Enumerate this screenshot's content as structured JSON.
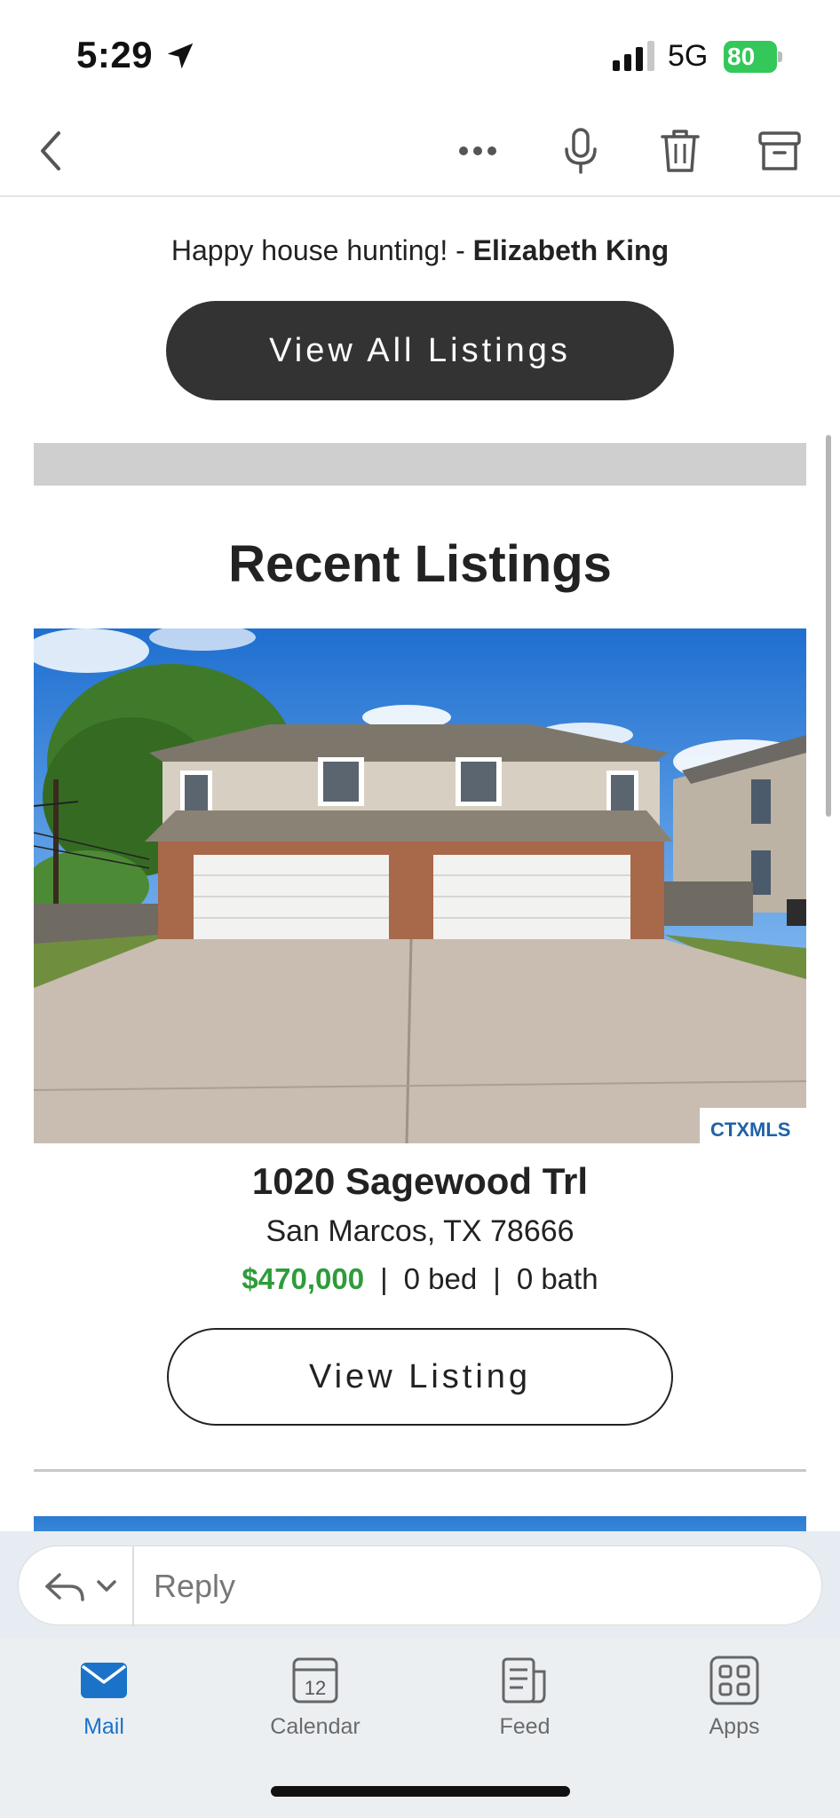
{
  "status_bar": {
    "time": "5:29",
    "network": "5G",
    "battery": "80"
  },
  "toolbar": {
    "back_icon": "chevron-left-icon",
    "more_icon": "ellipsis-icon",
    "mic_icon": "microphone-icon",
    "trash_icon": "trash-icon",
    "archive_icon": "archive-icon"
  },
  "email": {
    "signoff_text": "Happy house hunting! - ",
    "signoff_name": "Elizabeth King",
    "view_all_label": "View All Listings",
    "section_title": "Recent Listings",
    "listing": {
      "address": "1020 Sagewood Trl",
      "city": "San Marcos, TX 78666",
      "price": "$470,000",
      "beds": "0 bed",
      "baths": "0 bath",
      "separator": "|",
      "button_label": "View Listing",
      "photo_badge": "CTXMLS"
    }
  },
  "reply": {
    "placeholder": "Reply"
  },
  "tabs": [
    {
      "label": "Mail",
      "active": true
    },
    {
      "label": "Calendar",
      "date": "12"
    },
    {
      "label": "Feed"
    },
    {
      "label": "Apps"
    }
  ],
  "colors": {
    "accent": "#1a73c9",
    "price": "#2e9c3a",
    "dark_button": "#333333",
    "battery": "#34c759"
  }
}
